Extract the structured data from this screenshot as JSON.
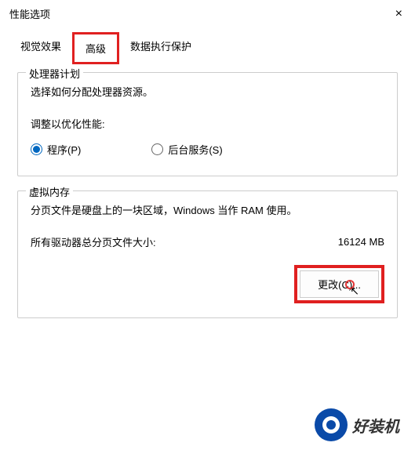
{
  "window": {
    "title": "性能选项"
  },
  "tabs": {
    "visual": "视觉效果",
    "advanced": "高级",
    "dep": "数据执行保护"
  },
  "processor": {
    "legend": "处理器计划",
    "desc": "选择如何分配处理器资源。",
    "adjust_label": "调整以优化性能:",
    "opt_programs": "程序(P)",
    "opt_background": "后台服务(S)"
  },
  "vm": {
    "legend": "虚拟内存",
    "desc": "分页文件是硬盘上的一块区域，Windows 当作 RAM 使用。",
    "total_label": "所有驱动器总分页文件大小:",
    "total_value": "16124 MB",
    "change_btn": "更改(C)..."
  },
  "watermark": {
    "text": "好装机"
  }
}
